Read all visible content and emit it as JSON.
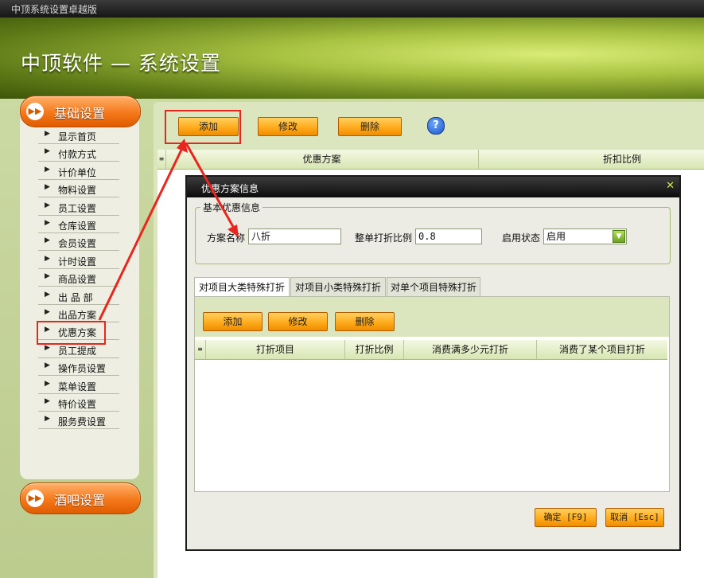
{
  "window": {
    "title": "中顶系统设置卓越版"
  },
  "banner": {
    "title": "中顶软件 — 系统设置"
  },
  "sidebar": {
    "section_basic": "基础设置",
    "section_bar": "酒吧设置",
    "items": [
      {
        "label": "显示首页"
      },
      {
        "label": "付款方式"
      },
      {
        "label": "计价单位"
      },
      {
        "label": "物料设置"
      },
      {
        "label": "员工设置"
      },
      {
        "label": "仓库设置"
      },
      {
        "label": "会员设置"
      },
      {
        "label": "计时设置"
      },
      {
        "label": "商品设置"
      },
      {
        "label": "出 品 部"
      },
      {
        "label": "出品方案"
      },
      {
        "label": "优惠方案"
      },
      {
        "label": "员工提成"
      },
      {
        "label": "操作员设置"
      },
      {
        "label": "菜单设置"
      },
      {
        "label": "特价设置"
      },
      {
        "label": "服务费设置"
      }
    ]
  },
  "toolbar": {
    "add": "添加",
    "edit": "修改",
    "delete": "删除"
  },
  "grid": {
    "columns": [
      "优惠方案",
      "折扣比例"
    ]
  },
  "dialog": {
    "title": "优惠方案信息",
    "group": "基本优惠信息",
    "name_label": "方案名称",
    "name_value": "八折",
    "ratio_label": "整单打折比例",
    "ratio_value": "0.8",
    "status_label": "启用状态",
    "status_value": "启用",
    "tabs": [
      "对项目大类特殊打折",
      "对项目小类特殊打折",
      "对单个项目特殊打折"
    ],
    "tab_toolbar": {
      "add": "添加",
      "edit": "修改",
      "delete": "删除"
    },
    "tab_columns": [
      "打折项目",
      "打折比例",
      "消费满多少元打折",
      "消费了某个项目打折"
    ],
    "ok": "确定 [F9]",
    "cancel": "取消 [Esc]"
  },
  "colors": {
    "accent_orange": "#f4781a",
    "highlight_red": "#e8261e",
    "banner_green": "#a8c241"
  }
}
